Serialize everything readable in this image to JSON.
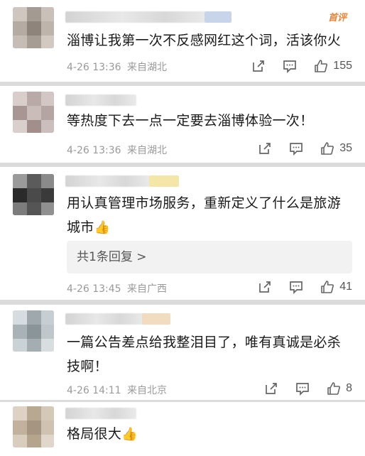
{
  "comments": [
    {
      "top_tag": "首评",
      "text": "淄博让我第一次不反感网红这个词，活该你火",
      "date": "4-26 13:36",
      "location": "来自湖北",
      "likes": "155",
      "emoji": ""
    },
    {
      "text": "等热度下去一点一定要去淄博体验一次！",
      "date": "4-26 13:36",
      "location": "来自湖北",
      "likes": "35",
      "emoji": ""
    },
    {
      "text_line1": "用认真管理市场服务，重新定义了什么是旅游",
      "text_line2": "城市",
      "emoji": "👍",
      "reply": "共1条回复 >",
      "date": "4-26 13:45",
      "location": "来自广西",
      "likes": "41"
    },
    {
      "text_line1": "一篇公告差点给我整泪目了，唯有真诚是必杀",
      "text_line2": "技啊！",
      "date": "4-26 14:11",
      "location": "来自北京",
      "likes": "8",
      "emoji": ""
    },
    {
      "text": "格局很大",
      "emoji": "👍"
    }
  ],
  "icons": [
    "share-icon",
    "comment-icon",
    "like-icon"
  ],
  "colors": {
    "top_tag": "#e8843a",
    "meta": "#9a9a9a",
    "separator": "#dcdcdc"
  }
}
